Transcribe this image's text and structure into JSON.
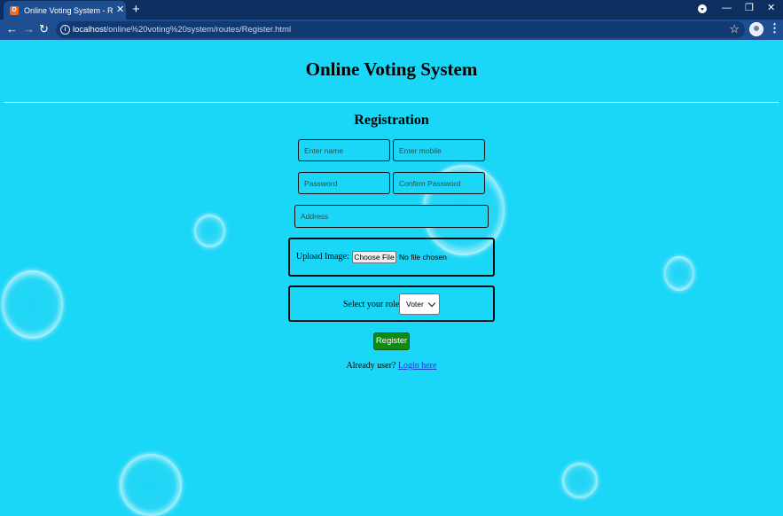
{
  "browser": {
    "tab_title": "Online Voting System - Registration",
    "tab_favicon_letter": "D",
    "new_tab_symbol": "+",
    "url_host": "localhost",
    "url_path": "/online%20voting%20system/routes/Register.html",
    "icons": [
      "back-icon",
      "forward-icon",
      "reload-icon",
      "info-icon",
      "star-icon",
      "profile-icon",
      "menu-icon",
      "minimize-icon",
      "restore-icon",
      "close-icon"
    ]
  },
  "page": {
    "title": "Online Voting System",
    "form_title": "Registration",
    "name_placeholder": "Enter name",
    "mobile_placeholder": "Enter mobile",
    "password_placeholder": "Password",
    "confirm_placeholder": "Confirm Password",
    "address_placeholder": "Address",
    "upload_label": "Upload Image:",
    "choose_file_label": "Choose File",
    "file_status": "No file chosen",
    "role_label": "Select your role:",
    "role_selected": "Voter",
    "register_label": "Register",
    "already_text": "Already user?",
    "login_link": "Login here"
  },
  "colors": {
    "background": "#1ad6f7",
    "register_button": "#0f8a12",
    "tab_bar": "#0c2f5f",
    "toolbar": "#1e4f93"
  }
}
